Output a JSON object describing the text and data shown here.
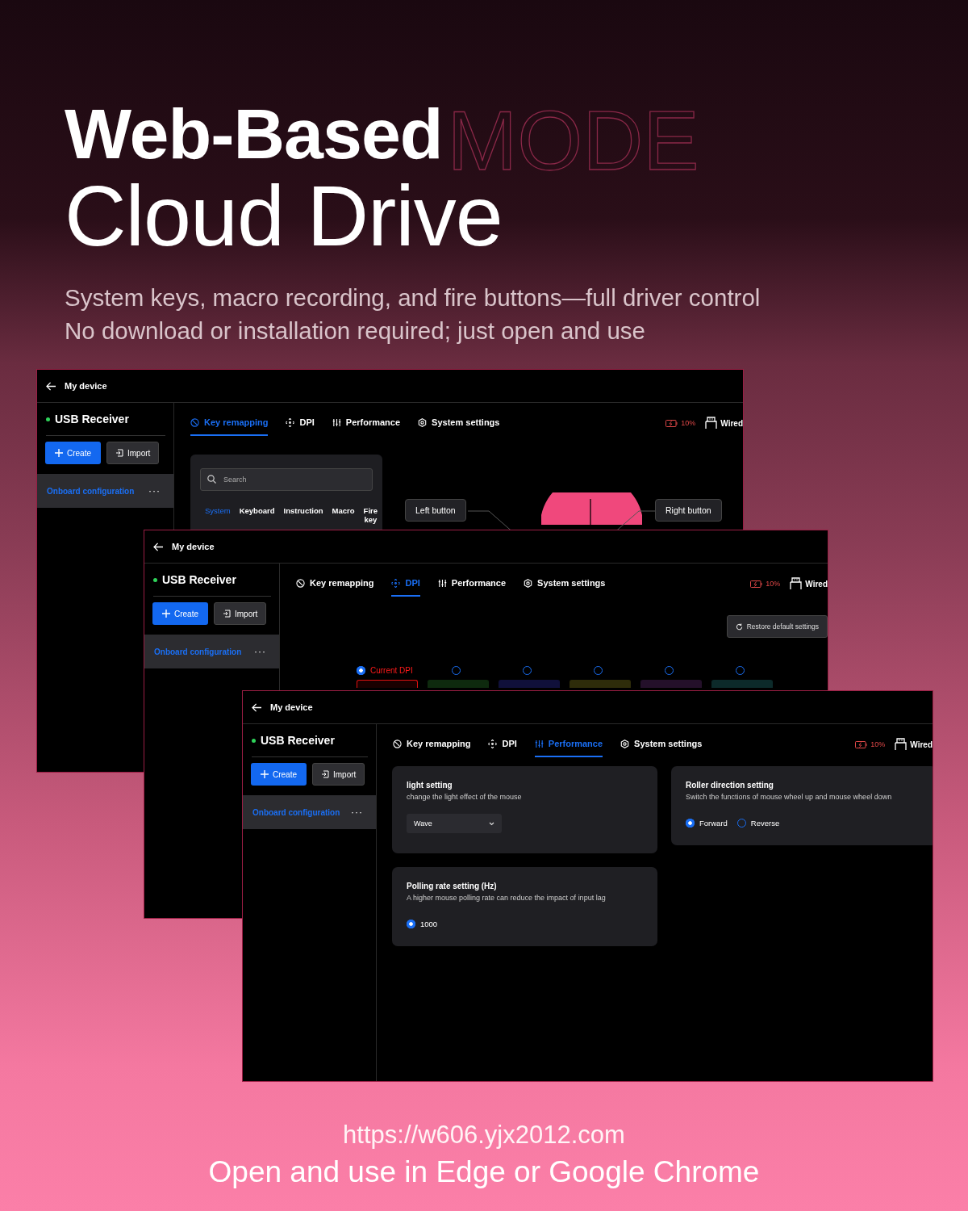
{
  "headline": {
    "outline_text": "MODE",
    "line_1": "Web-Based",
    "line_2": "Cloud Drive"
  },
  "subtitle": [
    "System keys, macro recording, and fire buttons—full driver control",
    "No download or installation required; just open and use"
  ],
  "windows": [
    {
      "kind": "key-remapping",
      "title": "My device",
      "device": "USB Receiver",
      "create": "Create",
      "import": "Import",
      "config": "Onboard configuration",
      "config_more": "···",
      "tabs": [
        {
          "label": "Key remapping",
          "selected": true
        },
        {
          "label": "DPI",
          "selected": false
        },
        {
          "label": "Performance",
          "selected": false
        },
        {
          "label": "System settings",
          "selected": false
        }
      ],
      "battery": "10%",
      "connection": "Wired",
      "search": {
        "placeholder": "Search"
      },
      "categories": [
        {
          "label": "System",
          "selected": true
        },
        {
          "label": "Keyboard",
          "selected": false
        },
        {
          "label": "Instruction",
          "selected": false
        },
        {
          "label": "Macro",
          "selected": false
        },
        {
          "label": "Fire key",
          "selected": false
        }
      ],
      "left_button": "Left button",
      "right_button": "Right button"
    },
    {
      "kind": "dpi",
      "title": "My device",
      "device": "USB Receiver",
      "create": "Create",
      "import": "Import",
      "config": "Onboard configuration",
      "config_more": "···",
      "tabs": [
        {
          "label": "Key remapping",
          "selected": false
        },
        {
          "label": "DPI",
          "selected": true
        },
        {
          "label": "Performance",
          "selected": false
        },
        {
          "label": "System settings",
          "selected": false
        }
      ],
      "battery": "10%",
      "connection": "Wired",
      "restore": "Restore default settings",
      "dpi_slots": [
        {
          "label": "Current DPI",
          "selected": true,
          "color": "#e01010"
        },
        {
          "selected": false,
          "color": "#0e2a0e"
        },
        {
          "selected": false,
          "color": "#10103a"
        },
        {
          "selected": false,
          "color": "#2e2c0a"
        },
        {
          "selected": false,
          "color": "#24102a"
        },
        {
          "selected": false,
          "color": "#0c2a2a"
        }
      ]
    },
    {
      "kind": "performance",
      "title": "My device",
      "device": "USB Receiver",
      "create": "Create",
      "import": "Import",
      "config": "Onboard configuration",
      "config_more": "···",
      "tabs": [
        {
          "label": "Key remapping",
          "selected": false
        },
        {
          "label": "DPI",
          "selected": false
        },
        {
          "label": "Performance",
          "selected": true
        },
        {
          "label": "System settings",
          "selected": false
        }
      ],
      "battery": "10%",
      "connection": "Wired",
      "cards": [
        {
          "kind": "select",
          "title": "light setting",
          "description": "change the light effect of the mouse",
          "value": "Wave"
        },
        {
          "kind": "radio",
          "title": "Roller direction setting",
          "description": "Switch the functions of mouse wheel up and mouse wheel down",
          "options": [
            {
              "label": "Forward",
              "selected": true
            },
            {
              "label": "Reverse",
              "selected": false
            }
          ]
        },
        {
          "kind": "radio",
          "title": "Polling rate setting (Hz)",
          "description": "A higher mouse polling rate can reduce the impact of input lag",
          "options": [
            {
              "label": "1000",
              "selected": true
            }
          ]
        }
      ]
    }
  ],
  "footer": {
    "url": "https://w606.yjx2012.com",
    "note": "Open and use in Edge or Google Chrome"
  }
}
